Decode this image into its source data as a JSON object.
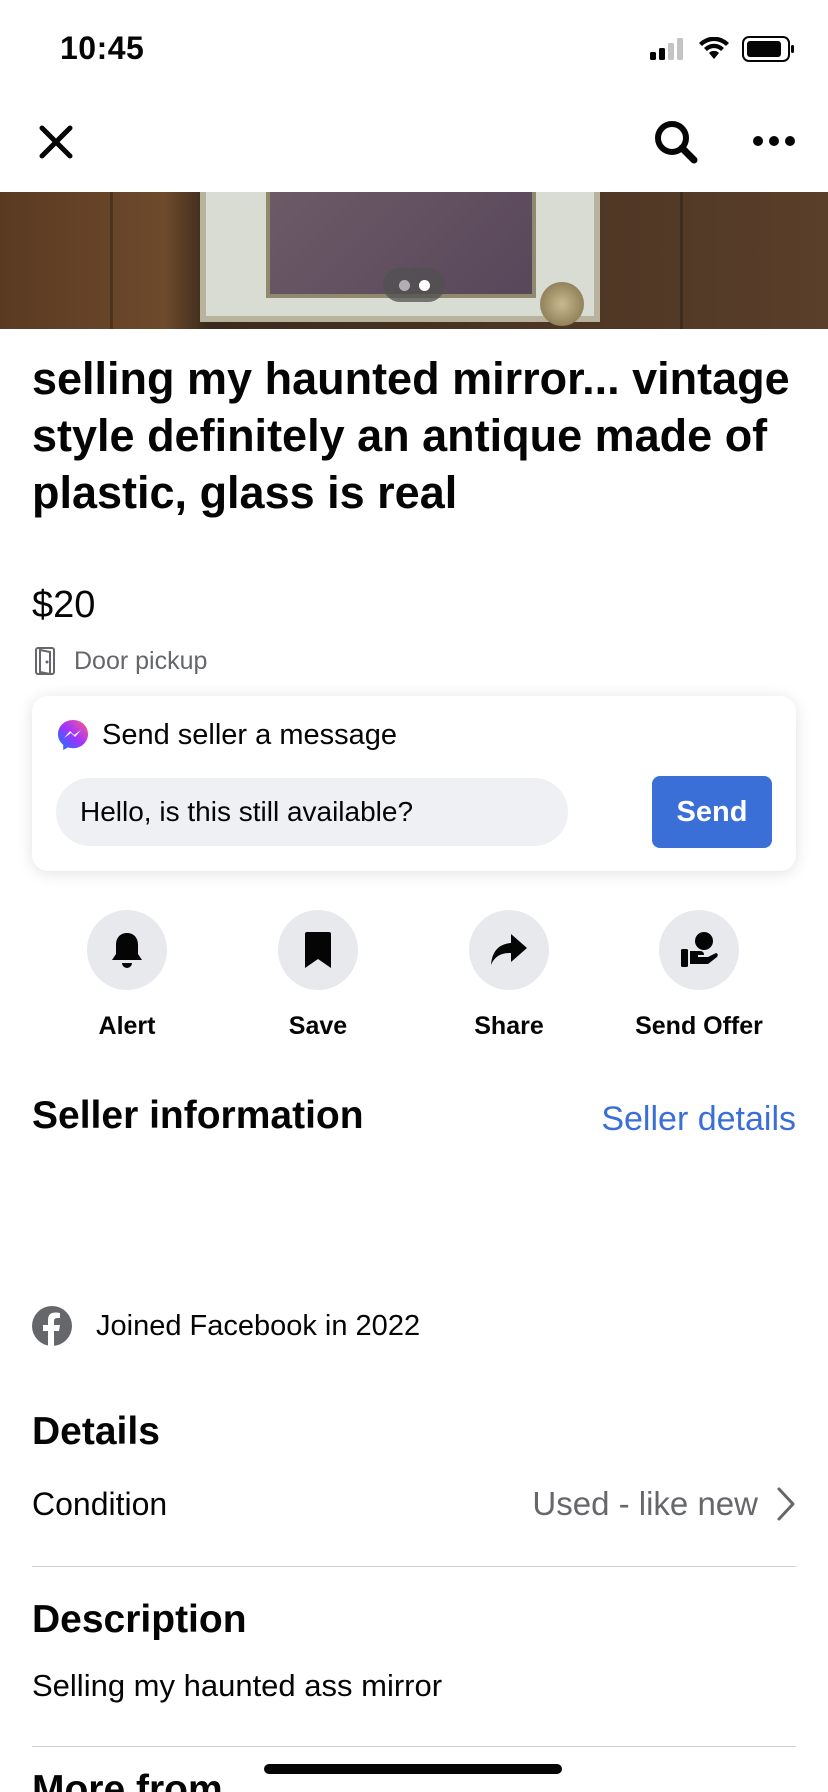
{
  "status": {
    "time": "10:45"
  },
  "listing": {
    "title": "selling my haunted mirror... vintage style definitely an antique made of plastic, glass is real",
    "price": "$20",
    "pickup": "Door pickup"
  },
  "message": {
    "header": "Send seller a message",
    "input_value": "Hello, is this still available?",
    "send_label": "Send"
  },
  "actions": [
    {
      "label": "Alert",
      "icon": "bell-icon"
    },
    {
      "label": "Save",
      "icon": "bookmark-icon"
    },
    {
      "label": "Share",
      "icon": "share-icon"
    },
    {
      "label": "Send Offer",
      "icon": "offer-icon"
    }
  ],
  "seller": {
    "title": "Seller information",
    "details_link": "Seller details",
    "joined": "Joined Facebook in 2022"
  },
  "details": {
    "title": "Details",
    "condition_label": "Condition",
    "condition_value": "Used - like new"
  },
  "description": {
    "title": "Description",
    "text": "Selling my haunted ass mirror"
  },
  "more": {
    "title": "More from"
  },
  "colors": {
    "accent": "#3a6fd8",
    "secondary_text": "#65676b"
  }
}
